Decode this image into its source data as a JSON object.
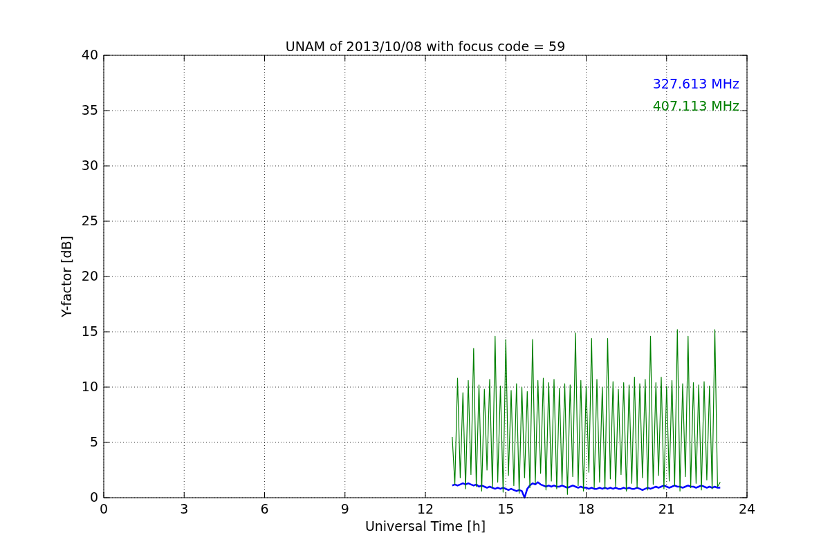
{
  "chart": {
    "chart_data": {
      "type": "line",
      "title": "UNAM of 2013/10/08 with focus code = 59",
      "xlabel": "Universal Time [h]",
      "ylabel": "Y-factor [dB]",
      "xlim": [
        0,
        24
      ],
      "ylim": [
        0,
        40
      ],
      "xticks": [
        0,
        3,
        6,
        9,
        12,
        15,
        18,
        21,
        24
      ],
      "yticks": [
        0,
        5,
        10,
        15,
        20,
        25,
        30,
        35,
        40
      ],
      "grid": true,
      "x": [
        13,
        13.1,
        13.2,
        13.3,
        13.4,
        13.5,
        13.6,
        13.7,
        13.8,
        13.9,
        14,
        14.1,
        14.2,
        14.3,
        14.4,
        14.5,
        14.6,
        14.7,
        14.8,
        14.9,
        15,
        15.1,
        15.2,
        15.3,
        15.4,
        15.5,
        15.6,
        15.7,
        15.8,
        15.9,
        16,
        16.1,
        16.2,
        16.3,
        16.4,
        16.5,
        16.6,
        16.7,
        16.8,
        16.9,
        17,
        17.1,
        17.2,
        17.3,
        17.4,
        17.5,
        17.6,
        17.7,
        17.8,
        17.9,
        18,
        18.1,
        18.2,
        18.3,
        18.4,
        18.5,
        18.6,
        18.7,
        18.8,
        18.9,
        19,
        19.1,
        19.2,
        19.3,
        19.4,
        19.5,
        19.6,
        19.7,
        19.8,
        19.9,
        20,
        20.1,
        20.2,
        20.3,
        20.4,
        20.5,
        20.6,
        20.7,
        20.8,
        20.9,
        21,
        21.1,
        21.2,
        21.3,
        21.4,
        21.5,
        21.6,
        21.7,
        21.8,
        21.9,
        22,
        22.1,
        22.2,
        22.3,
        22.4,
        22.5,
        22.6,
        22.7,
        22.8,
        22.9,
        23
      ],
      "series": [
        {
          "name": "327.613 MHz",
          "color": "#0000ff",
          "values": [
            1.1,
            1.2,
            1.1,
            1.2,
            1.3,
            1.2,
            1.3,
            1.2,
            1.1,
            1.2,
            1.0,
            1.1,
            1.0,
            0.9,
            1.0,
            0.9,
            0.8,
            0.9,
            0.8,
            0.9,
            0.8,
            0.7,
            0.8,
            0.7,
            0.6,
            0.7,
            0.6,
            0.0,
            0.8,
            1.1,
            1.3,
            1.2,
            1.4,
            1.2,
            1.1,
            1.0,
            1.1,
            1.0,
            1.1,
            1.0,
            1.0,
            1.1,
            1.0,
            0.9,
            1.0,
            1.1,
            1.0,
            0.9,
            1.0,
            0.9,
            0.9,
            0.8,
            0.9,
            0.8,
            0.8,
            0.9,
            0.8,
            0.9,
            0.8,
            0.9,
            0.8,
            0.9,
            0.8,
            0.8,
            0.9,
            0.8,
            0.9,
            0.8,
            0.8,
            0.9,
            0.8,
            0.7,
            0.8,
            0.9,
            0.8,
            0.9,
            1.0,
            0.9,
            1.0,
            1.1,
            1.0,
            0.9,
            1.0,
            1.1,
            1.0,
            1.0,
            0.9,
            1.0,
            1.1,
            1.0,
            1.0,
            0.9,
            1.0,
            1.1,
            1.0,
            0.9,
            1.0,
            0.9,
            1.0,
            0.9,
            0.9
          ]
        },
        {
          "name": "407.113 MHz",
          "color": "#008000",
          "values": [
            5.5,
            1.2,
            10.8,
            1.8,
            9.5,
            0.8,
            10.6,
            2.1,
            13.5,
            1.0,
            10.2,
            0.6,
            9.8,
            2.5,
            10.7,
            0.9,
            14.6,
            1.4,
            10.1,
            0.5,
            14.3,
            2.0,
            9.7,
            1.1,
            10.3,
            0.4,
            10.0,
            1.8,
            9.6,
            0.9,
            14.3,
            1.3,
            10.6,
            2.2,
            10.8,
            0.7,
            10.4,
            1.5,
            10.7,
            0.8,
            9.9,
            1.2,
            10.3,
            0.3,
            10.2,
            1.9,
            14.9,
            1.1,
            10.6,
            0.6,
            10.1,
            2.3,
            14.4,
            0.9,
            10.7,
            1.4,
            10.0,
            0.8,
            14.4,
            1.7,
            10.5,
            1.0,
            9.8,
            2.1,
            10.4,
            0.6,
            10.2,
            1.3,
            10.9,
            0.9,
            10.3,
            1.8,
            10.7,
            0.7,
            14.6,
            1.2,
            10.4,
            2.0,
            10.9,
            0.8,
            10.1,
            1.5,
            10.6,
            1.1,
            15.2,
            0.6,
            10.3,
            1.9,
            14.6,
            0.9,
            10.4,
            1.3,
            10.2,
            0.7,
            10.5,
            1.6,
            10.1,
            0.8,
            15.2,
            1.0,
            1.4
          ]
        }
      ]
    }
  }
}
